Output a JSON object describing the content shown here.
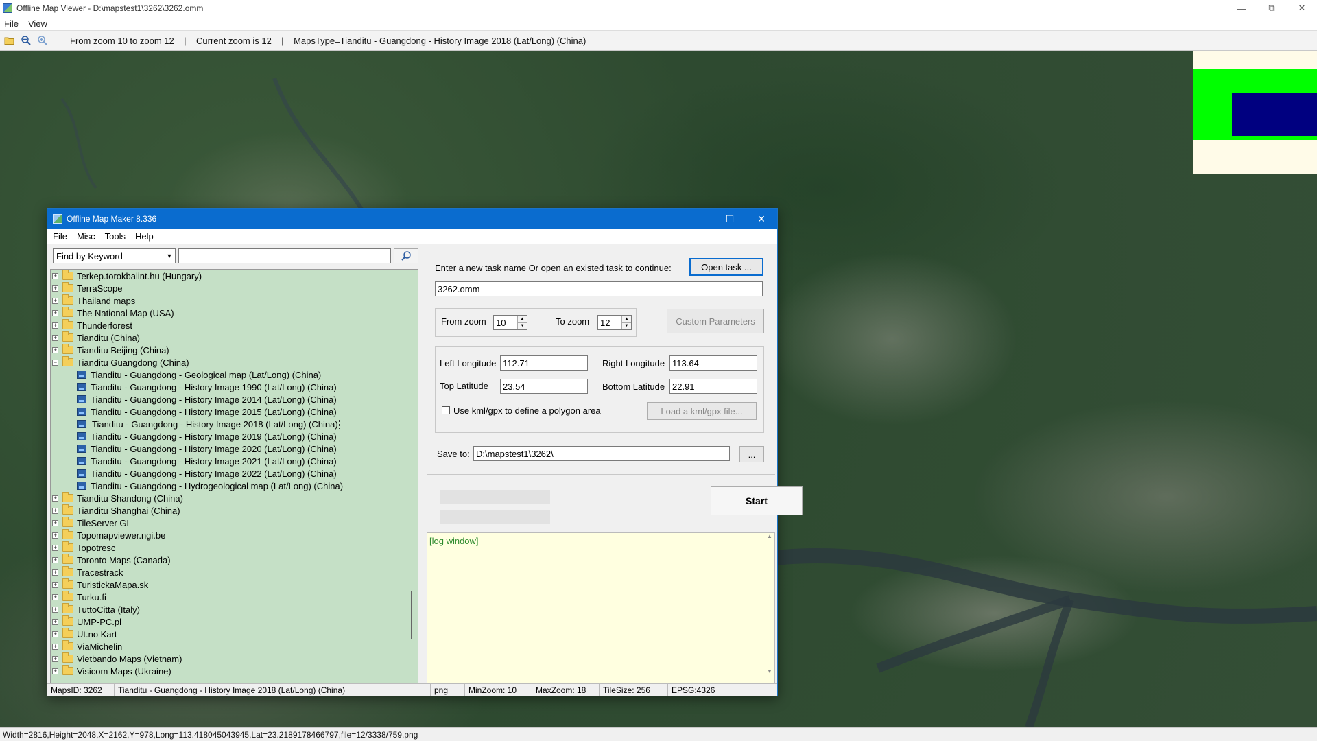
{
  "window": {
    "title": "Offline Map Viewer - D:\\mapstest1\\3262\\3262.omm"
  },
  "menu": [
    "File",
    "View"
  ],
  "toolbar": {
    "info": "From zoom 10 to zoom 12    |    Current zoom is 12    |    MapsType=Tianditu - Guangdong - History Image 2018 (Lat/Long) (China)"
  },
  "status": "Width=2816,Height=2048,X=2162,Y=978,Long=113.418045043945,Lat=23.2189178466797,file=12/3338/759.png",
  "overview": {
    "frame_color": "#00ff00",
    "viewport_color": "#000080"
  },
  "dialog": {
    "title": "Offline Map Maker 8.336",
    "menu": [
      "File",
      "Misc",
      "Tools",
      "Help"
    ],
    "search": {
      "mode": "Find by Keyword",
      "query": ""
    },
    "tree": [
      {
        "label": "Terkep.torokbalint.hu (Hungary)",
        "type": "folder"
      },
      {
        "label": "TerraScope",
        "type": "folder"
      },
      {
        "label": "Thailand maps",
        "type": "folder"
      },
      {
        "label": "The National Map (USA)",
        "type": "folder"
      },
      {
        "label": "Thunderforest",
        "type": "folder"
      },
      {
        "label": "Tianditu (China)",
        "type": "folder"
      },
      {
        "label": "Tianditu Beijing (China)",
        "type": "folder"
      },
      {
        "label": "Tianditu Guangdong (China)",
        "type": "folder-open"
      },
      {
        "label": "Tianditu - Guangdong - Geological map (Lat/Long) (China)",
        "type": "map"
      },
      {
        "label": "Tianditu - Guangdong - History Image 1990 (Lat/Long) (China)",
        "type": "map"
      },
      {
        "label": "Tianditu - Guangdong - History Image 2014 (Lat/Long) (China)",
        "type": "map"
      },
      {
        "label": "Tianditu - Guangdong - History Image 2015 (Lat/Long) (China)",
        "type": "map"
      },
      {
        "label": "Tianditu - Guangdong - History Image 2018 (Lat/Long) (China)",
        "type": "map",
        "selected": true
      },
      {
        "label": "Tianditu - Guangdong - History Image 2019 (Lat/Long) (China)",
        "type": "map"
      },
      {
        "label": "Tianditu - Guangdong - History Image 2020 (Lat/Long) (China)",
        "type": "map"
      },
      {
        "label": "Tianditu - Guangdong - History Image 2021 (Lat/Long) (China)",
        "type": "map"
      },
      {
        "label": "Tianditu - Guangdong - History Image 2022 (Lat/Long) (China)",
        "type": "map"
      },
      {
        "label": "Tianditu - Guangdong - Hydrogeological map (Lat/Long) (China)",
        "type": "map"
      },
      {
        "label": "Tianditu Shandong (China)",
        "type": "folder"
      },
      {
        "label": "Tianditu Shanghai (China)",
        "type": "folder"
      },
      {
        "label": "TileServer GL",
        "type": "folder"
      },
      {
        "label": "Topomapviewer.ngi.be",
        "type": "folder"
      },
      {
        "label": "Topotresc",
        "type": "folder"
      },
      {
        "label": "Toronto Maps (Canada)",
        "type": "folder"
      },
      {
        "label": "Tracestrack",
        "type": "folder"
      },
      {
        "label": "TuristickaMapa.sk",
        "type": "folder"
      },
      {
        "label": "Turku.fi",
        "type": "folder"
      },
      {
        "label": "TuttoCitta (Italy)",
        "type": "folder"
      },
      {
        "label": "UMP-PC.pl",
        "type": "folder"
      },
      {
        "label": "Ut.no Kart",
        "type": "folder"
      },
      {
        "label": "ViaMichelin",
        "type": "folder"
      },
      {
        "label": "Vietbando Maps (Vietnam)",
        "type": "folder"
      },
      {
        "label": "Visicom Maps (Ukraine)",
        "type": "folder"
      }
    ],
    "task": {
      "prompt": "Enter a new task name Or open an existed task to continue:",
      "open_label": "Open task ...",
      "name": "3262.omm"
    },
    "zoom": {
      "from_label": "From zoom",
      "from": "10",
      "to_label": "To zoom",
      "to": "12",
      "custom_label": "Custom Parameters"
    },
    "bounds": {
      "left_label": "Left Longitude",
      "left": "112.71",
      "right_label": "Right Longitude",
      "right": "113.64",
      "top_label": "Top Latitude",
      "top": "23.54",
      "bottom_label": "Bottom Latitude",
      "bottom": "22.91"
    },
    "kml": {
      "label": "Use kml/gpx to define a polygon area",
      "checked": false,
      "load_label": "Load a kml/gpx file..."
    },
    "save": {
      "label": "Save to:",
      "path": "D:\\mapstest1\\3262\\",
      "browse_label": "..."
    },
    "start_label": "Start",
    "log": "[log window]",
    "statusbar": {
      "maps_id": "MapsID: 3262",
      "maps_name": "Tianditu - Guangdong - History Image 2018 (Lat/Long) (China)",
      "format": "png",
      "min_zoom": "MinZoom: 10",
      "max_zoom": "MaxZoom: 18",
      "tile_size": "TileSize: 256",
      "epsg": "EPSG:4326"
    }
  }
}
